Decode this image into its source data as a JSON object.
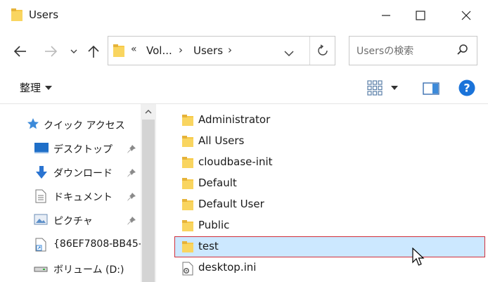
{
  "window": {
    "title": "Users",
    "controls": [
      "minimize-icon",
      "maximize-icon",
      "close-icon"
    ]
  },
  "nav": {
    "back_icon": "arrow-left-icon",
    "forward_icon": "arrow-right-icon",
    "recent_icon": "chevron-down-icon",
    "up_icon": "arrow-up-icon"
  },
  "address": {
    "overflow": "«",
    "segments": [
      "Vol...",
      "Users"
    ],
    "separator": "›"
  },
  "search": {
    "placeholder": "Usersの検索",
    "value": ""
  },
  "commandbar": {
    "organize_label": "整理",
    "view_icon": "large-icons-icon",
    "preview_icon": "preview-pane-icon",
    "help_icon": "help-icon"
  },
  "navpane": {
    "items": [
      {
        "label": "クイック アクセス",
        "icon": "star-icon",
        "pinned": false
      },
      {
        "label": "デスクトップ",
        "icon": "desktop-icon",
        "pinned": true
      },
      {
        "label": "ダウンロード",
        "icon": "download-icon",
        "pinned": true
      },
      {
        "label": "ドキュメント",
        "icon": "document-icon",
        "pinned": true
      },
      {
        "label": "ピクチャ",
        "icon": "pictures-icon",
        "pinned": true
      },
      {
        "label": "{86EF7808-BB45-",
        "icon": "shortcut-icon",
        "pinned": false
      },
      {
        "label": "ボリューム (D:)",
        "icon": "drive-icon",
        "pinned": false
      }
    ]
  },
  "files": [
    {
      "name": "Administrator",
      "type": "folder",
      "selected": false
    },
    {
      "name": "All Users",
      "type": "folder",
      "selected": false
    },
    {
      "name": "cloudbase-init",
      "type": "folder",
      "selected": false
    },
    {
      "name": "Default",
      "type": "folder",
      "selected": false
    },
    {
      "name": "Default User",
      "type": "folder",
      "selected": false
    },
    {
      "name": "Public",
      "type": "folder",
      "selected": false
    },
    {
      "name": "test",
      "type": "folder",
      "selected": true
    },
    {
      "name": "desktop.ini",
      "type": "settings-file",
      "selected": false
    }
  ],
  "colors": {
    "folder": "#f7c948",
    "selection_bg": "#cce8ff",
    "selection_border": "#d0303c",
    "help": "#1a73d9",
    "accent": "#3c8ad9"
  }
}
